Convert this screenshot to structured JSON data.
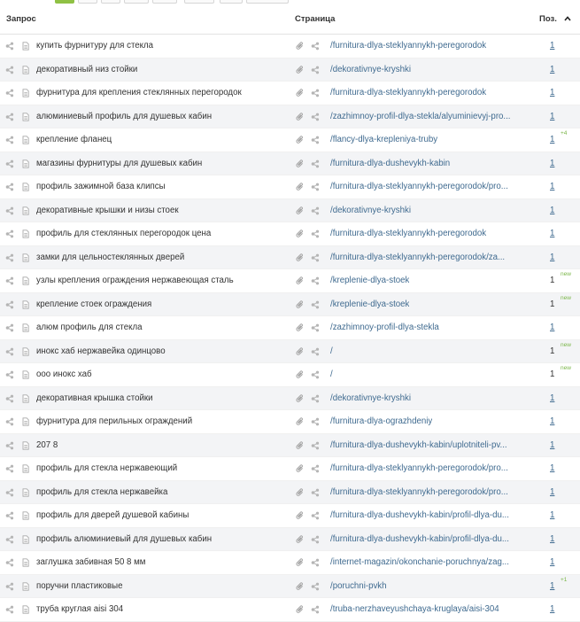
{
  "header": {
    "query": "Запрос",
    "page": "Страница",
    "position": "Поз."
  },
  "colors": {
    "accent": "#8fc144",
    "link": "#3f6a8f",
    "badge": "#7ab648",
    "alt_row": "#f3f4f6"
  },
  "icons": {
    "share": "share-icon",
    "document": "document-icon",
    "clip": "paperclip-icon",
    "sort": "chevron-up-icon"
  },
  "rows": [
    {
      "query": "купить фурнитуру для стекла",
      "url": "/furnitura-dlya-steklyannykh-peregorodok",
      "pos": "1",
      "link": true,
      "badge": ""
    },
    {
      "query": "декоративный низ стойки",
      "url": "/dekorativnye-kryshki",
      "pos": "1",
      "link": true,
      "badge": ""
    },
    {
      "query": "фурнитура для крепления стеклянных перегородок",
      "url": "/furnitura-dlya-steklyannykh-peregorodok",
      "pos": "1",
      "link": true,
      "badge": ""
    },
    {
      "query": "алюминиевый профиль для душевых кабин",
      "url": "/zazhimnoy-profil-dlya-stekla/alyuminievyj-pro...",
      "pos": "1",
      "link": true,
      "badge": ""
    },
    {
      "query": "крепление фланец",
      "url": "/flancy-dlya-krepleniya-truby",
      "pos": "1",
      "link": true,
      "badge": "+4"
    },
    {
      "query": "магазины фурнитуры для душевых кабин",
      "url": "/furnitura-dlya-dushevykh-kabin",
      "pos": "1",
      "link": true,
      "badge": ""
    },
    {
      "query": "профиль зажимной база клипсы",
      "url": "/furnitura-dlya-steklyannykh-peregorodok/pro...",
      "pos": "1",
      "link": true,
      "badge": ""
    },
    {
      "query": "декоративные крышки и низы стоек",
      "url": "/dekorativnye-kryshki",
      "pos": "1",
      "link": true,
      "badge": ""
    },
    {
      "query": "профиль для стеклянных перегородок цена",
      "url": "/furnitura-dlya-steklyannykh-peregorodok",
      "pos": "1",
      "link": true,
      "badge": ""
    },
    {
      "query": "замки для цельностеклянных дверей",
      "url": "/furnitura-dlya-steklyannykh-peregorodok/za...",
      "pos": "1",
      "link": true,
      "badge": ""
    },
    {
      "query": "узлы крепления ограждения нержавеющая сталь",
      "url": "/kreplenie-dlya-stoek",
      "pos": "1",
      "link": false,
      "badge": "new"
    },
    {
      "query": "крепление стоек ограждения",
      "url": "/kreplenie-dlya-stoek",
      "pos": "1",
      "link": false,
      "badge": "new"
    },
    {
      "query": "алюм профиль для стекла",
      "url": "/zazhimnoy-profil-dlya-stekla",
      "pos": "1",
      "link": true,
      "badge": ""
    },
    {
      "query": "инокс хаб нержавейка одинцово",
      "url": "/",
      "pos": "1",
      "link": false,
      "badge": "new"
    },
    {
      "query": "ооо инокс хаб",
      "url": "/",
      "pos": "1",
      "link": false,
      "badge": "new"
    },
    {
      "query": "декоративная крышка стойки",
      "url": "/dekorativnye-kryshki",
      "pos": "1",
      "link": true,
      "badge": ""
    },
    {
      "query": "фурнитура для перильных ограждений",
      "url": "/furnitura-dlya-ograzhdeniy",
      "pos": "1",
      "link": true,
      "badge": ""
    },
    {
      "query": "207 8",
      "url": "/furnitura-dlya-dushevykh-kabin/uplotniteli-pv...",
      "pos": "1",
      "link": true,
      "badge": ""
    },
    {
      "query": "профиль для стекла нержавеющий",
      "url": "/furnitura-dlya-steklyannykh-peregorodok/pro...",
      "pos": "1",
      "link": true,
      "badge": ""
    },
    {
      "query": "профиль для стекла нержавейка",
      "url": "/furnitura-dlya-steklyannykh-peregorodok/pro...",
      "pos": "1",
      "link": true,
      "badge": ""
    },
    {
      "query": "профиль для дверей душевой кабины",
      "url": "/furnitura-dlya-dushevykh-kabin/profil-dlya-du...",
      "pos": "1",
      "link": true,
      "badge": ""
    },
    {
      "query": "профиль алюминиевый для душевых кабин",
      "url": "/furnitura-dlya-dushevykh-kabin/profil-dlya-du...",
      "pos": "1",
      "link": true,
      "badge": ""
    },
    {
      "query": "заглушка забивная 50 8 мм",
      "url": "/internet-magazin/okonchanie-poruchnya/zag...",
      "pos": "1",
      "link": true,
      "badge": ""
    },
    {
      "query": "поручни пластиковые",
      "url": "/poruchni-pvkh",
      "pos": "1",
      "link": true,
      "badge": "+1"
    },
    {
      "query": "труба круглая aisi 304",
      "url": "/truba-nerzhaveyushchaya-kruglaya/aisi-304",
      "pos": "1",
      "link": true,
      "badge": ""
    }
  ]
}
